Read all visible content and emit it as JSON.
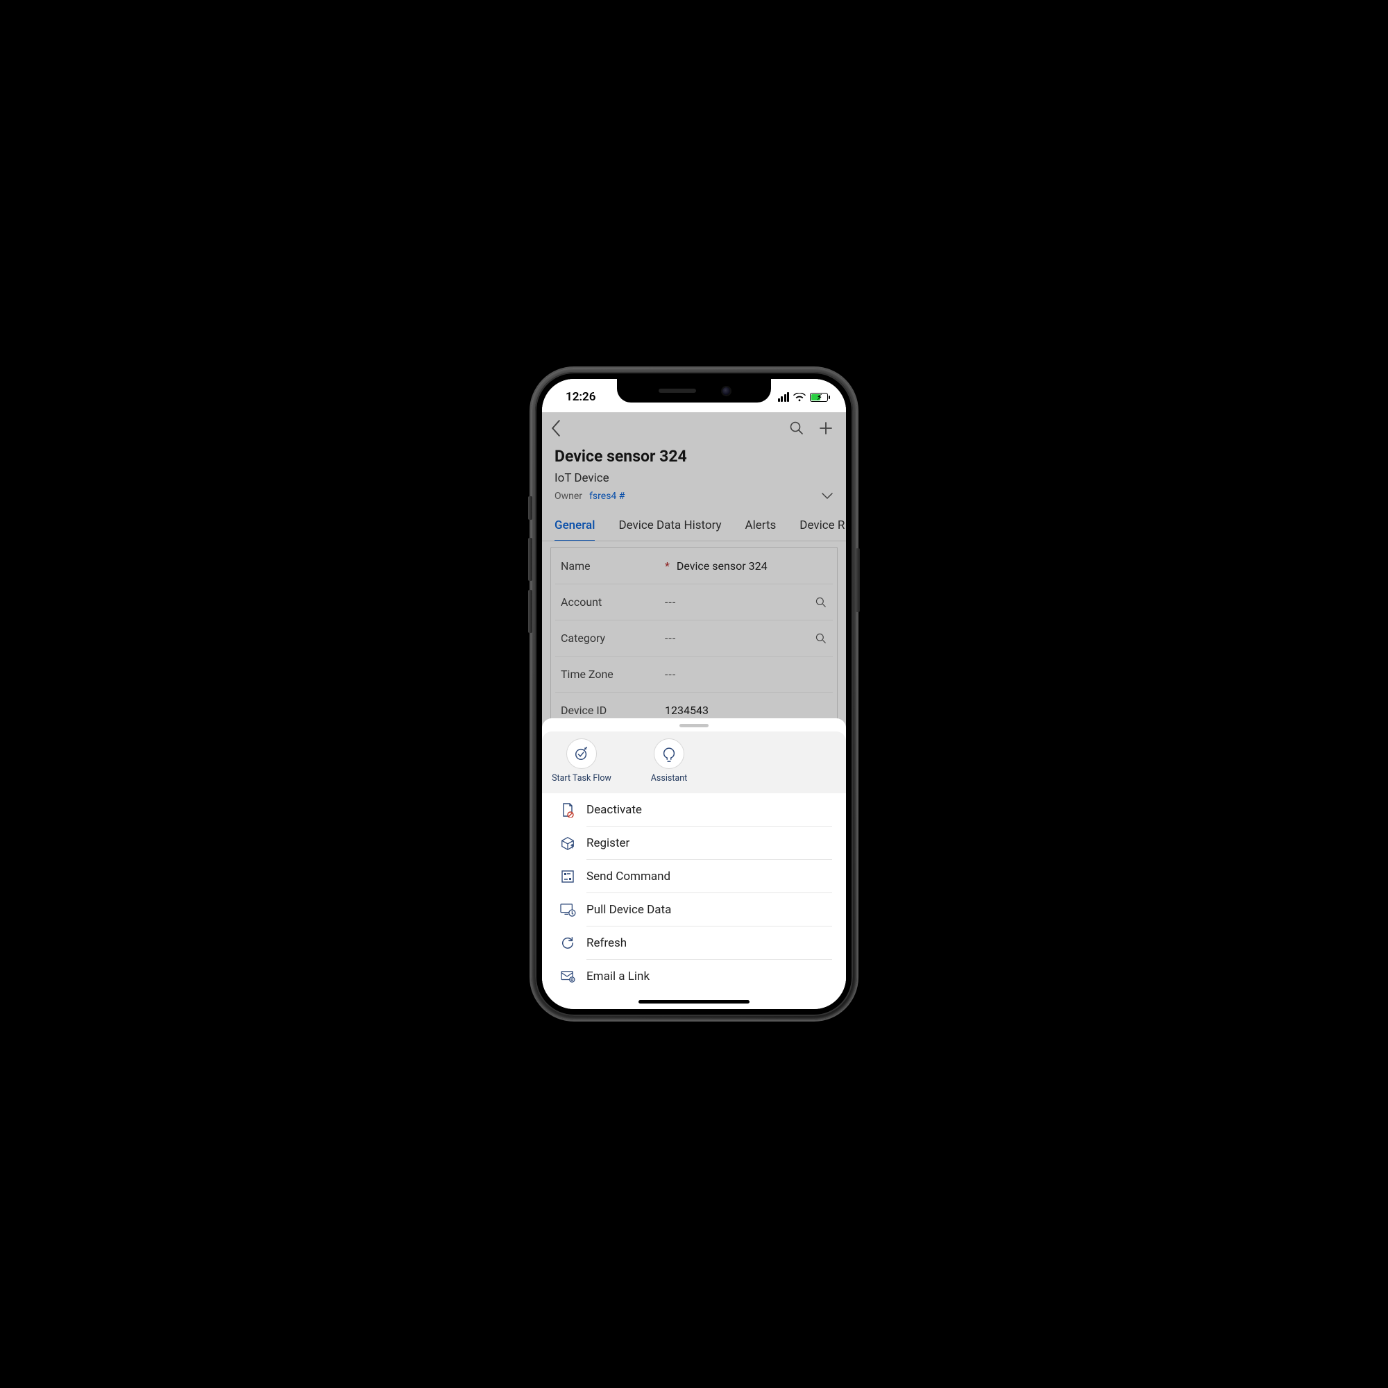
{
  "status": {
    "time": "12:26"
  },
  "header": {
    "title": "Device sensor 324",
    "subtitle": "IoT Device",
    "owner_label": "Owner",
    "owner_value": "fsres4 #"
  },
  "tabs": [
    {
      "label": "General",
      "active": true
    },
    {
      "label": "Device Data History",
      "active": false
    },
    {
      "label": "Alerts",
      "active": false
    },
    {
      "label": "Device R",
      "active": false
    }
  ],
  "fields": {
    "name": {
      "label": "Name",
      "value": "Device sensor 324",
      "required": true
    },
    "account": {
      "label": "Account",
      "value": "---",
      "lookup": true
    },
    "category": {
      "label": "Category",
      "value": "---",
      "lookup": true
    },
    "timezone": {
      "label": "Time Zone",
      "value": "---"
    },
    "deviceid": {
      "label": "Device ID",
      "value": "1234543"
    }
  },
  "sheet": {
    "quick": [
      {
        "label": "Start Task Flow"
      },
      {
        "label": "Assistant"
      }
    ],
    "items": [
      {
        "label": "Deactivate"
      },
      {
        "label": "Register"
      },
      {
        "label": "Send Command"
      },
      {
        "label": "Pull Device Data"
      },
      {
        "label": "Refresh"
      },
      {
        "label": "Email a Link"
      }
    ]
  }
}
